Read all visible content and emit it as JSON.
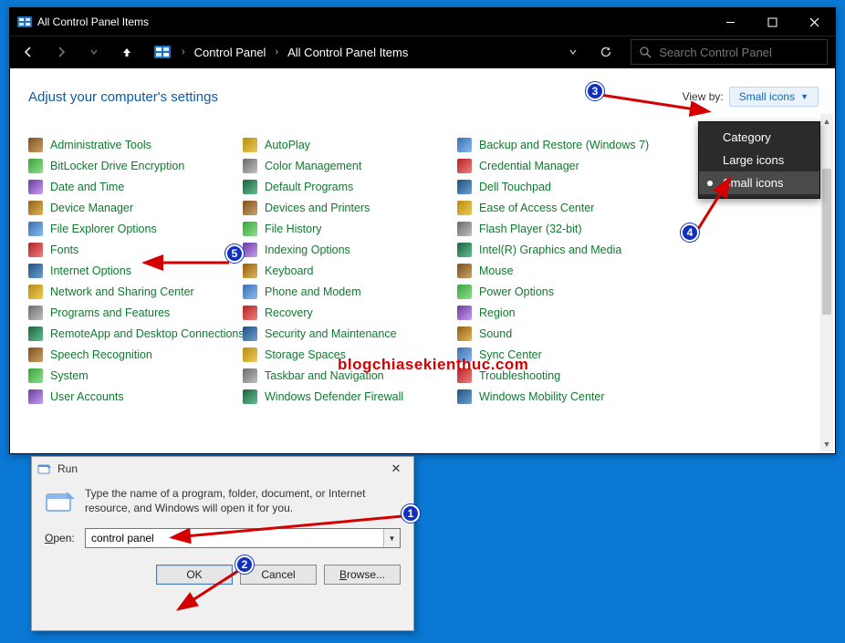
{
  "window": {
    "title": "All Control Panel Items"
  },
  "breadcrumb": {
    "root": "Control Panel",
    "current": "All Control Panel Items"
  },
  "search": {
    "placeholder": "Search Control Panel"
  },
  "header": {
    "title": "Adjust your computer's settings",
    "viewby_label": "View by:",
    "viewby_value": "Small icons"
  },
  "viewby_menu": {
    "items": [
      "Category",
      "Large icons",
      "Small icons"
    ],
    "selected": "Small icons"
  },
  "items": {
    "col1": [
      "Administrative Tools",
      "BitLocker Drive Encryption",
      "Date and Time",
      "Device Manager",
      "File Explorer Options",
      "Fonts",
      "Internet Options",
      "Network and Sharing Center",
      "Programs and Features",
      "RemoteApp and Desktop Connections",
      "Speech Recognition",
      "System",
      "User Accounts"
    ],
    "col2": [
      "AutoPlay",
      "Color Management",
      "Default Programs",
      "Devices and Printers",
      "File History",
      "Indexing Options",
      "Keyboard",
      "Phone and Modem",
      "Recovery",
      "Security and Maintenance",
      "Storage Spaces",
      "Taskbar and Navigation",
      "Windows Defender Firewall"
    ],
    "col3": [
      "Backup and Restore (Windows 7)",
      "Credential Manager",
      "Dell Touchpad",
      "Ease of Access Center",
      "Flash Player (32-bit)",
      "Intel(R) Graphics and Media",
      "Mouse",
      "Power Options",
      "Region",
      "Sound",
      "Sync Center",
      "Troubleshooting",
      "Windows Mobility Center"
    ]
  },
  "run": {
    "title": "Run",
    "desc": "Type the name of a program, folder, document, or Internet resource, and Windows will open it for you.",
    "open_label": "Open:",
    "open_value": "control panel",
    "ok": "OK",
    "cancel": "Cancel",
    "browse": "Browse..."
  },
  "watermark": "blogchiasekienthuc.com",
  "annotations": {
    "b1": "1",
    "b2": "2",
    "b3": "3",
    "b4": "4",
    "b5": "5"
  },
  "icon_cycle": [
    "c1",
    "c2",
    "c3",
    "c4",
    "c5",
    "c6",
    "c7",
    "c8",
    "c9",
    "c10"
  ]
}
